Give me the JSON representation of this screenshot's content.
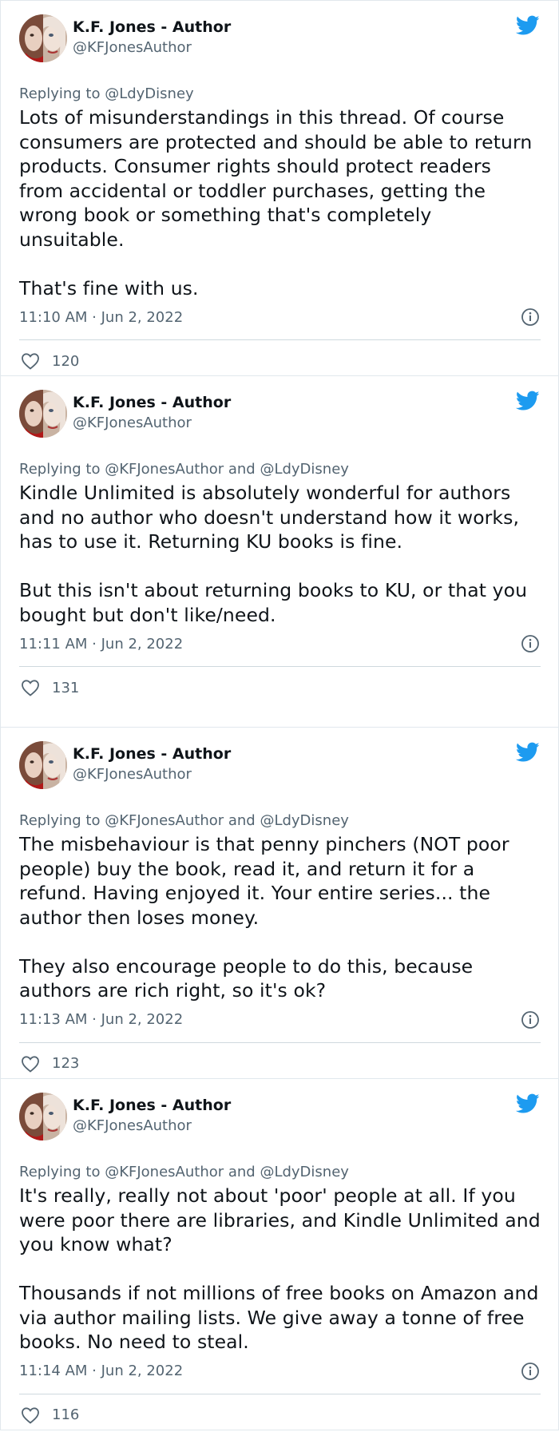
{
  "tweets": [
    {
      "author_name": "K.F. Jones - Author",
      "author_handle": "@KFJonesAuthor",
      "replying_prefix": "Replying to ",
      "replying_to": "@LdyDisney",
      "text": "Lots of misunderstandings in this thread. Of course consumers are protected and should be able to return products. Consumer rights should protect readers from accidental or toddler purchases, getting the wrong book or something that's completely unsuitable.\n\nThat's fine with us.",
      "timestamp": "11:10 AM · Jun 2, 2022",
      "likes": "120"
    },
    {
      "author_name": "K.F. Jones - Author",
      "author_handle": "@KFJonesAuthor",
      "replying_prefix": "Replying to ",
      "replying_to": "@KFJonesAuthor and @LdyDisney",
      "text": "Kindle Unlimited is absolutely wonderful for authors and no author who doesn't understand how it works, has to use it. Returning KU books is fine.\n\nBut this isn't about returning books to KU, or that you bought but don't like/need.",
      "timestamp": "11:11 AM · Jun 2, 2022",
      "likes": "131"
    },
    {
      "author_name": "K.F. Jones - Author",
      "author_handle": "@KFJonesAuthor",
      "replying_prefix": "Replying to ",
      "replying_to": "@KFJonesAuthor and @LdyDisney",
      "text": "The misbehaviour is that penny pinchers (NOT poor people) buy the book, read it, and return it for a refund. Having enjoyed it. Your entire series... the author then loses money.\n\nThey also encourage people to do this, because authors are rich right, so it's ok?",
      "timestamp": "11:13 AM · Jun 2, 2022",
      "likes": "123"
    },
    {
      "author_name": "K.F. Jones - Author",
      "author_handle": "@KFJonesAuthor",
      "replying_prefix": "Replying to ",
      "replying_to": "@KFJonesAuthor and @LdyDisney",
      "text": "It's really, really not about 'poor' people at all. If you were poor there are libraries, and Kindle Unlimited and you know what?\n\nThousands if not millions of free books on Amazon and via author mailing lists. We give away a tonne of free books. No need to steal.",
      "timestamp": "11:14 AM · Jun 2, 2022",
      "likes": "116"
    }
  ],
  "icons": {
    "brand": "twitter-bird-icon",
    "info": "info-icon",
    "like": "heart-icon"
  },
  "colors": {
    "brand": "#1d9bf0",
    "text": "#0f1419",
    "muted": "#536471",
    "border": "#e1e8ed"
  }
}
